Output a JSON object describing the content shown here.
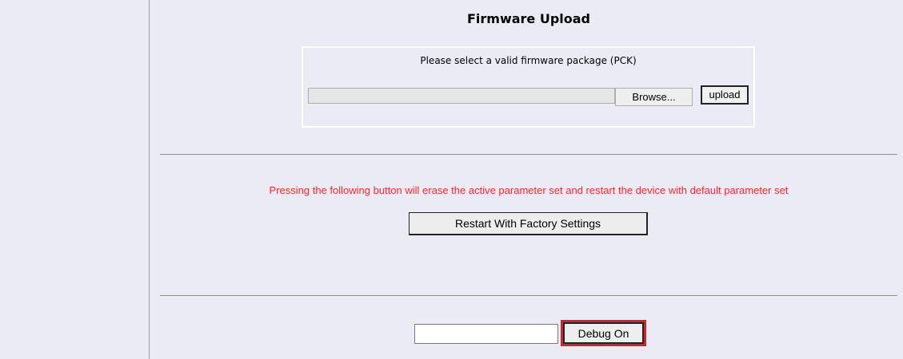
{
  "firmware": {
    "title": "Firmware Upload",
    "instructions": "Please select a valid firmware package (PCK)",
    "file_path_value": "",
    "browse_label": "Browse...",
    "upload_label": "upload"
  },
  "factory": {
    "warning": "Pressing the following button will erase the active parameter set and restart the device with default parameter set",
    "restart_label": "Restart With Factory Settings",
    "warning_color": "#ff2a2a"
  },
  "debug": {
    "input_value": "",
    "button_label": "Debug On",
    "highlight_color": "#d8202a"
  }
}
